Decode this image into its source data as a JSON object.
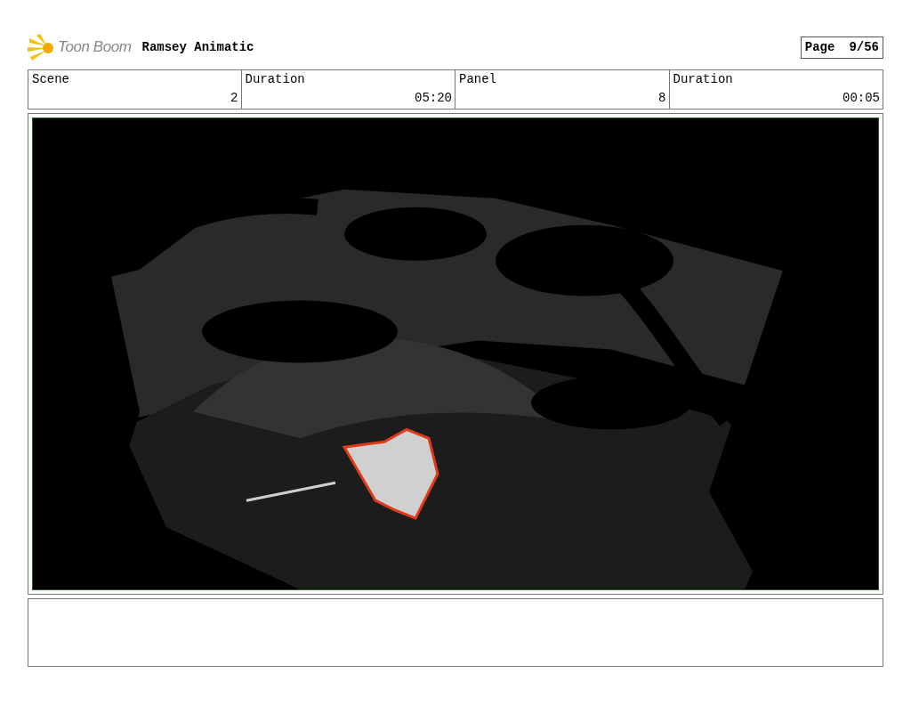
{
  "header": {
    "logo_text": "Toon Boom",
    "title": "Ramsey Animatic",
    "page_label": "Page",
    "page_number": "9/56"
  },
  "info_cells": [
    {
      "heading": "Scene",
      "entry": "2"
    },
    {
      "heading": "Duration",
      "entry": "05:20"
    },
    {
      "heading": "Panel",
      "entry": "8"
    },
    {
      "heading": "Duration",
      "entry": "00:05"
    }
  ]
}
